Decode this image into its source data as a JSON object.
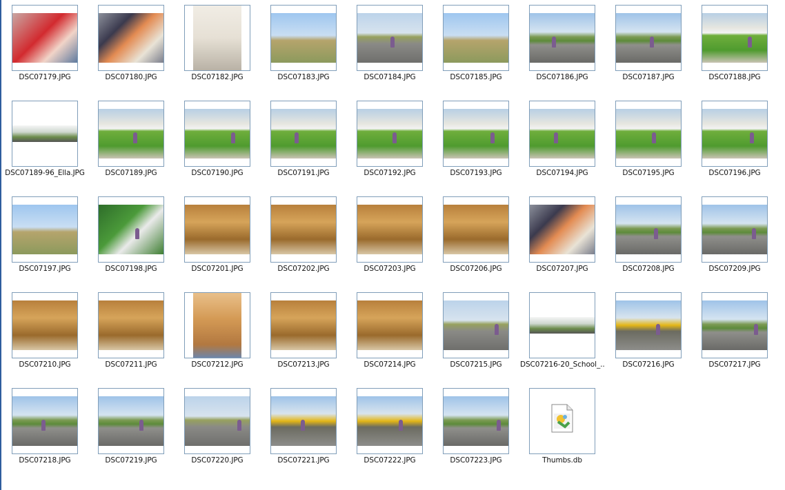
{
  "files": [
    {
      "name": "DSC07179.JPG",
      "scene": "red"
    },
    {
      "name": "DSC07180.JPG",
      "scene": "baby"
    },
    {
      "name": "DSC07182.JPG",
      "scene": "room",
      "orientation": "portrait"
    },
    {
      "name": "DSC07183.JPG",
      "scene": "sky"
    },
    {
      "name": "DSC07184.JPG",
      "scene": "road"
    },
    {
      "name": "DSC07185.JPG",
      "scene": "sky"
    },
    {
      "name": "DSC07186.JPG",
      "scene": "street"
    },
    {
      "name": "DSC07187.JPG",
      "scene": "street"
    },
    {
      "name": "DSC07188.JPG",
      "scene": "lawn"
    },
    {
      "name": "DSC07189-96_Ella.JPG",
      "scene": "pano"
    },
    {
      "name": "DSC07189.JPG",
      "scene": "lawn"
    },
    {
      "name": "DSC07190.JPG",
      "scene": "lawn"
    },
    {
      "name": "DSC07191.JPG",
      "scene": "lawn"
    },
    {
      "name": "DSC07192.JPG",
      "scene": "lawn"
    },
    {
      "name": "DSC07193.JPG",
      "scene": "lawn"
    },
    {
      "name": "DSC07194.JPG",
      "scene": "lawn"
    },
    {
      "name": "DSC07195.JPG",
      "scene": "lawn"
    },
    {
      "name": "DSC07196.JPG",
      "scene": "lawn"
    },
    {
      "name": "DSC07197.JPG",
      "scene": "sky"
    },
    {
      "name": "DSC07198.JPG",
      "scene": "grass"
    },
    {
      "name": "DSC07201.JPG",
      "scene": "indoor"
    },
    {
      "name": "DSC07202.JPG",
      "scene": "indoor"
    },
    {
      "name": "DSC07203.JPG",
      "scene": "indoor"
    },
    {
      "name": "DSC07206.JPG",
      "scene": "indoor"
    },
    {
      "name": "DSC07207.JPG",
      "scene": "baby"
    },
    {
      "name": "DSC07208.JPG",
      "scene": "street"
    },
    {
      "name": "DSC07209.JPG",
      "scene": "street"
    },
    {
      "name": "DSC07210.JPG",
      "scene": "indoor"
    },
    {
      "name": "DSC07211.JPG",
      "scene": "indoor"
    },
    {
      "name": "DSC07212.JPG",
      "scene": "tv",
      "orientation": "portrait"
    },
    {
      "name": "DSC07213.JPG",
      "scene": "indoor"
    },
    {
      "name": "DSC07214.JPG",
      "scene": "indoor"
    },
    {
      "name": "DSC07215.JPG",
      "scene": "road"
    },
    {
      "name": "DSC07216-20_School_...",
      "scene": "pano"
    },
    {
      "name": "DSC07216.JPG",
      "scene": "bus"
    },
    {
      "name": "DSC07217.JPG",
      "scene": "street"
    },
    {
      "name": "DSC07218.JPG",
      "scene": "street"
    },
    {
      "name": "DSC07219.JPG",
      "scene": "street"
    },
    {
      "name": "DSC07220.JPG",
      "scene": "road"
    },
    {
      "name": "DSC07221.JPG",
      "scene": "bus"
    },
    {
      "name": "DSC07222.JPG",
      "scene": "bus"
    },
    {
      "name": "DSC07223.JPG",
      "scene": "street"
    },
    {
      "name": "Thumbs.db",
      "scene": "file-icon"
    }
  ]
}
